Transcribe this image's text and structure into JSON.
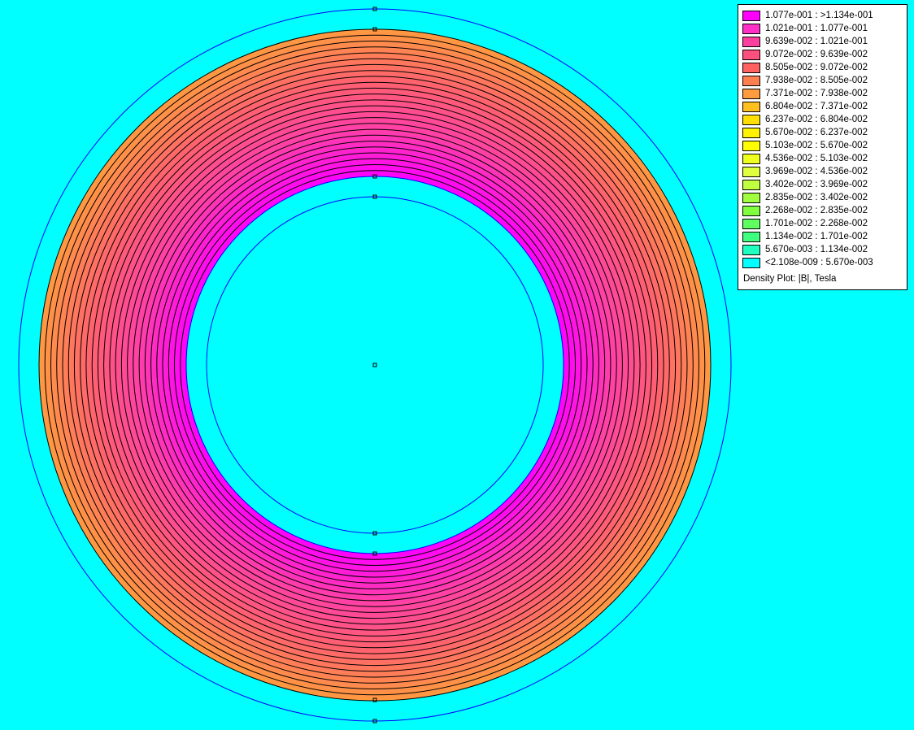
{
  "plot": {
    "background_color": "#00FFFF",
    "contour_color": "#000000",
    "boundary_color": "#0000FF",
    "magnet_inner_color": "#FF00FF",
    "magnet_outer_color": "#FF9B3F",
    "magnet_contour_count": 25
  },
  "legend": {
    "caption": "Density Plot: |B|, Tesla",
    "entries": [
      {
        "label": "1.077e-001 : >1.134e-001",
        "color": "#FF00FF"
      },
      {
        "label": "1.021e-001 : 1.077e-001",
        "color": "#FF2FC8"
      },
      {
        "label": "9.639e-002 : 1.021e-001",
        "color": "#FF3F9F"
      },
      {
        "label": "9.072e-002 : 9.639e-002",
        "color": "#FF4F7F"
      },
      {
        "label": "8.505e-002 : 9.072e-002",
        "color": "#FF6060"
      },
      {
        "label": "7.938e-002 : 8.505e-002",
        "color": "#FF7F4F"
      },
      {
        "label": "7.371e-002 : 7.938e-002",
        "color": "#FF9B3F"
      },
      {
        "label": "6.804e-002 : 7.371e-002",
        "color": "#FFBF1F"
      },
      {
        "label": "6.237e-002 : 6.804e-002",
        "color": "#FFDF00"
      },
      {
        "label": "5.670e-002 : 6.237e-002",
        "color": "#FFF200"
      },
      {
        "label": "5.103e-002 : 5.670e-002",
        "color": "#FFFF00"
      },
      {
        "label": "4.536e-002 : 5.103e-002",
        "color": "#EEFF1F"
      },
      {
        "label": "3.969e-002 : 4.536e-002",
        "color": "#DFFF3F"
      },
      {
        "label": "3.402e-002 : 3.969e-002",
        "color": "#BFFF3F"
      },
      {
        "label": "2.835e-002 : 3.402e-002",
        "color": "#9FFF3F"
      },
      {
        "label": "2.268e-002 : 2.835e-002",
        "color": "#7FFF3F"
      },
      {
        "label": "1.701e-002 : 2.268e-002",
        "color": "#5FFF5F"
      },
      {
        "label": "1.134e-002 : 1.701e-002",
        "color": "#3FFF7F"
      },
      {
        "label": "5.670e-003 : 1.134e-002",
        "color": "#1FFFBF"
      },
      {
        "label": "<2.108e-009 : 5.670e-003",
        "color": "#00FFFF"
      }
    ]
  }
}
